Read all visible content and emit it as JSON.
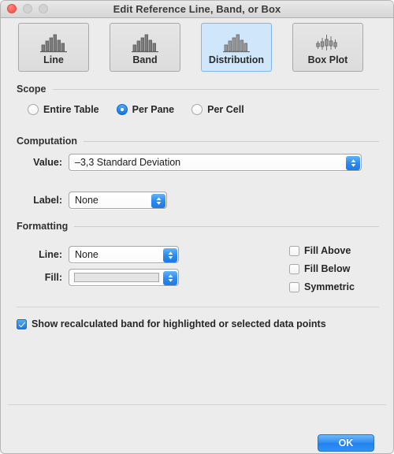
{
  "window": {
    "title": "Edit Reference Line, Band, or Box",
    "controls": {
      "close": "close-button",
      "minimize": "minimize-button",
      "zoom": "zoom-button"
    }
  },
  "tabs": [
    {
      "label": "Line",
      "icon": "distribution-bars-icon",
      "selected": false
    },
    {
      "label": "Band",
      "icon": "distribution-bars-icon",
      "selected": false
    },
    {
      "label": "Distribution",
      "icon": "distribution-bars-icon",
      "selected": true
    },
    {
      "label": "Box Plot",
      "icon": "box-plot-icon",
      "selected": false
    }
  ],
  "scope": {
    "heading": "Scope",
    "options": [
      {
        "label": "Entire Table",
        "selected": false
      },
      {
        "label": "Per Pane",
        "selected": true
      },
      {
        "label": "Per Cell",
        "selected": false
      }
    ]
  },
  "computation": {
    "heading": "Computation",
    "value": {
      "label": "Value:",
      "selected": "–3,3 Standard Deviation"
    },
    "label_field": {
      "label": "Label:",
      "selected": "None"
    }
  },
  "formatting": {
    "heading": "Formatting",
    "line": {
      "label": "Line:",
      "selected": "None"
    },
    "fill": {
      "label": "Fill:",
      "selected": "",
      "swatch_color": "#e4e4e4"
    },
    "checkboxes": [
      {
        "label": "Fill Above",
        "checked": false
      },
      {
        "label": "Fill Below",
        "checked": false
      },
      {
        "label": "Symmetric",
        "checked": false
      }
    ]
  },
  "recalculated": {
    "label": "Show recalculated band for highlighted or selected data points",
    "checked": true
  },
  "footer": {
    "ok_label": "OK"
  },
  "colors": {
    "accent": "#2a8bf0",
    "selected_tab_bg": "#cfe6fb",
    "window_bg": "#ececec"
  }
}
